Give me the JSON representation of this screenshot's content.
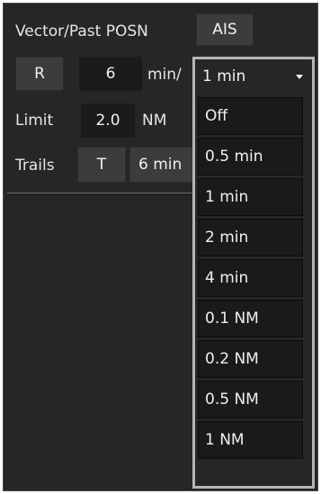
{
  "header": {
    "title": "Vector/Past POSN",
    "ais_label": "AIS"
  },
  "vector": {
    "mode_label": "R",
    "value": "6",
    "unit": "min/"
  },
  "limit": {
    "label": "Limit",
    "value": "2.0",
    "unit": "NM"
  },
  "trails": {
    "label": "Trails",
    "mode_label": "T",
    "value": "6 min"
  },
  "dropdown": {
    "selected": "1 min",
    "options": [
      "Off",
      "0.5 min",
      "1 min",
      "2 min",
      "4 min",
      "0.1 NM",
      "0.2 NM",
      "0.5 NM",
      "1 NM"
    ]
  }
}
